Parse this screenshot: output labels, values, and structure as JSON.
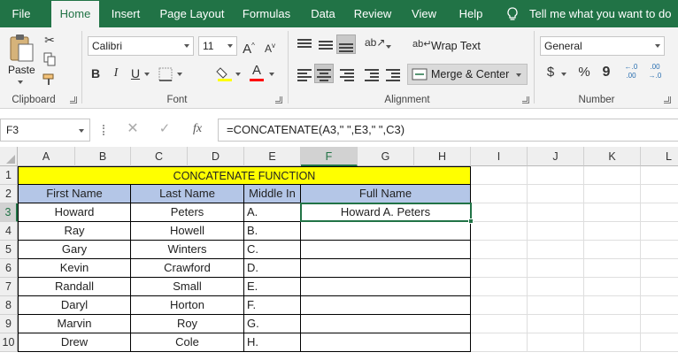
{
  "tabs": [
    {
      "label": "File"
    },
    {
      "label": "Home"
    },
    {
      "label": "Insert"
    },
    {
      "label": "Page Layout"
    },
    {
      "label": "Formulas"
    },
    {
      "label": "Data"
    },
    {
      "label": "Review"
    },
    {
      "label": "View"
    },
    {
      "label": "Help"
    }
  ],
  "tellme": "Tell me what you want to do",
  "clipboard": {
    "paste": "Paste",
    "label": "Clipboard"
  },
  "font": {
    "name": "Calibri",
    "size": "11",
    "label": "Font",
    "grow": "A",
    "shrink": "A",
    "bold": "B",
    "italic": "I",
    "underline": "U",
    "color_letter": "A",
    "font_color": "#ff0000",
    "highlight_color": "#ffff00"
  },
  "alignment": {
    "wrap": "Wrap Text",
    "merge": "Merge & Center",
    "label": "Alignment",
    "orientation": "ab"
  },
  "number": {
    "format": "General",
    "label": "Number",
    "currency": "$",
    "percent": "%",
    "comma": "9",
    "inc_dec": "←.0\n.00",
    "dec_dec": ".00\n→.0"
  },
  "formula_bar": {
    "namebox": "F3",
    "formula": "=CONCATENATE(A3,\" \",E3,\" \",C3)",
    "fx": "fx"
  },
  "columns": [
    "A",
    "B",
    "C",
    "D",
    "E",
    "F",
    "G",
    "H",
    "I",
    "J",
    "K",
    "L"
  ],
  "rows": [
    "1",
    "2",
    "3",
    "4",
    "5",
    "6",
    "7",
    "8",
    "9",
    "10"
  ],
  "sheet": {
    "title": "CONCATENATE FUNCTION",
    "headers": {
      "first": "First Name",
      "last": "Last Name",
      "middle": "Middle In",
      "full": "Full Name"
    },
    "people": [
      {
        "first": "Howard",
        "last": "Peters",
        "middle": "A.",
        "full": "Howard A. Peters"
      },
      {
        "first": "Ray",
        "last": "Howell",
        "middle": "B.",
        "full": ""
      },
      {
        "first": "Gary",
        "last": "Winters",
        "middle": "C.",
        "full": ""
      },
      {
        "first": "Kevin",
        "last": "Crawford",
        "middle": "D.",
        "full": ""
      },
      {
        "first": "Randall",
        "last": "Small",
        "middle": "E.",
        "full": ""
      },
      {
        "first": "Daryl",
        "last": "Horton",
        "middle": "F.",
        "full": ""
      },
      {
        "first": "Marvin",
        "last": "Roy",
        "middle": "G.",
        "full": ""
      },
      {
        "first": "Drew",
        "last": "Cole",
        "middle": "H.",
        "full": ""
      }
    ],
    "title_fill": "#ffff00",
    "header_fill": "#b4c6e7",
    "accent": "#217346"
  }
}
